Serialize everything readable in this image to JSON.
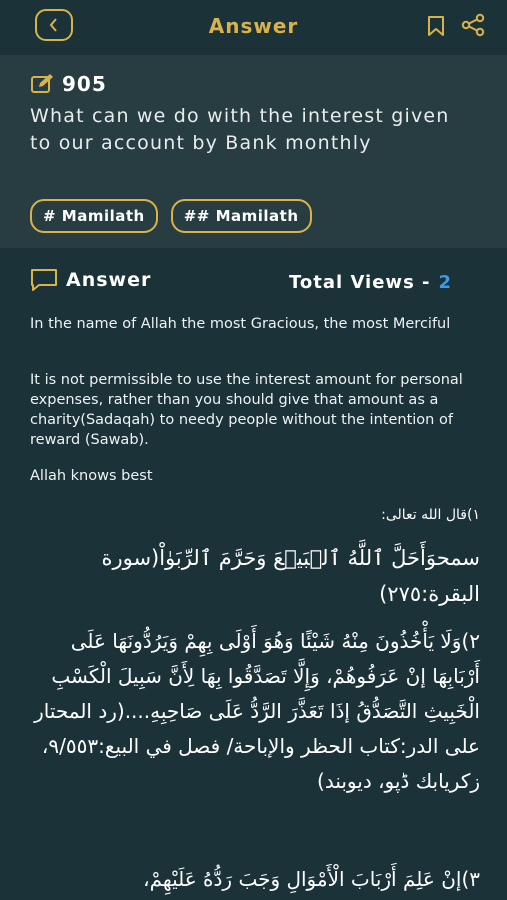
{
  "header": {
    "title": "Answer",
    "back_icon": "chevron-left-icon",
    "bookmark_icon": "bookmark-icon",
    "share_icon": "share-icon",
    "accent": "#d8b24a"
  },
  "question": {
    "number": "905",
    "text": "What can we do with the interest given to our account by Bank monthly",
    "tags": [
      "# Mamilath",
      "## Mamilath"
    ]
  },
  "answer": {
    "label": "Answer",
    "views_label": "Total Views -",
    "views_count": "2",
    "intro": "In the name of Allah the most Gracious, the most Merciful",
    "ruling": "It is not permissible to use the interest amount for personal expenses, rather than you should give that amount as a charity(Sadaqah) to needy people without the intention of reward (Sawab).",
    "closing": "Allah knows best",
    "arabic_heading": "١)قال الله تعالى:",
    "arabic_1": "سمحوَأَحَلَّ ٱللَّهُ ٱلۡبَيۡعَ وَحَرَّمَ ٱلرِّبَوٰاْ(سورة البقرة:٢٧٥)",
    "arabic_2": "٢)وَلَا يَأْخُذُونَ مِنْهُ شَيْئًا وَهُوَ أَوْلَى بِهِمْ وَيَرُدُّونَهَا عَلَى أَرْبَابِهَا إنْ عَرَفُوهُمْ، وَإِلَّا تَصَدَّقُوا بِهَا لِأَنَّ سَبِيلَ الْكَسْبِ الْخَبِيثِ التَّصَدُّقُ إذَا تَعَذَّرَ الرَّدُّ عَلَى صَاحِبِهِ....(رد المحتار على الدر:كتاب الحظر والإباحة/ فصل في البيع:٩/٥٥٣، زكريابك ڈپو، ديوبند)",
    "arabic_3": "٣)إنْ عَلِمَ أَرْبَابَ الْأَمْوَالِ وَجَبَ رَدُّهُ عَلَيْهِمْ،"
  }
}
